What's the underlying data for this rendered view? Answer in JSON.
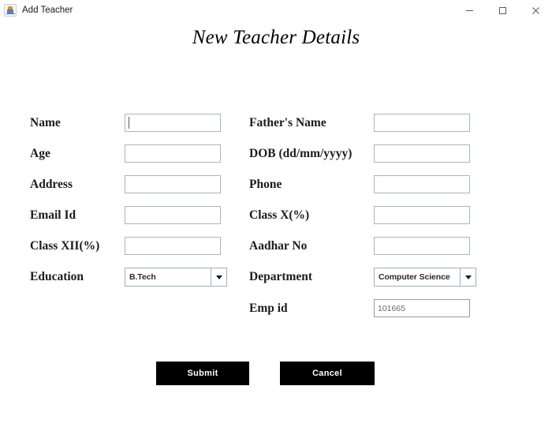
{
  "window": {
    "title": "Add Teacher",
    "icon": "java-cup-icon",
    "controls": {
      "minimize": "minimize-button",
      "maximize": "maximize-button",
      "close": "close-button"
    }
  },
  "heading": {
    "text": "New Teacher Details"
  },
  "form": {
    "left_column": [
      {
        "label": "Name",
        "value": "",
        "type": "text",
        "focused": true
      },
      {
        "label": "Age",
        "value": "",
        "type": "text",
        "focused": false
      },
      {
        "label": "Address",
        "value": "",
        "type": "text",
        "focused": false
      },
      {
        "label": "Email Id",
        "value": "",
        "type": "text",
        "focused": false
      },
      {
        "label": "Class XII(%)",
        "value": "",
        "type": "text",
        "focused": false
      },
      {
        "label": "Education",
        "value": "B.Tech",
        "type": "select"
      }
    ],
    "right_column": [
      {
        "label": "Father's Name",
        "value": "",
        "type": "text"
      },
      {
        "label": "DOB (dd/mm/yyyy)",
        "value": "",
        "type": "text"
      },
      {
        "label": "Phone",
        "value": "",
        "type": "text"
      },
      {
        "label": "Class X(%)",
        "value": "",
        "type": "text"
      },
      {
        "label": "Aadhar No",
        "value": "",
        "type": "text"
      },
      {
        "label": "Department",
        "value": "Computer Science",
        "type": "select"
      },
      {
        "label": "Emp id",
        "value": "101665",
        "type": "text",
        "readonly": true
      }
    ]
  },
  "buttons": {
    "submit": "Submit",
    "cancel": "Cancel"
  },
  "colors": {
    "button_bg": "#000000",
    "button_text": "#ffffff",
    "field_border": "#aab4c2",
    "text": "#1c1c1c"
  }
}
